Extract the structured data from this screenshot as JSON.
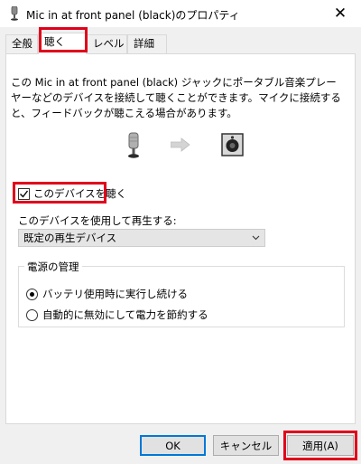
{
  "window": {
    "title": "Mic in at front panel (black)のプロパティ",
    "close_glyph": "✕"
  },
  "tabs": [
    {
      "label": "全般",
      "active": false
    },
    {
      "label": "聴く",
      "active": true
    },
    {
      "label": "レベル",
      "active": false
    },
    {
      "label": "詳細",
      "active": false
    }
  ],
  "listen": {
    "description": "この Mic in at front panel (black) ジャックにポータブル音楽プレーヤーなどのデバイスを接続して聴くことができます。マイクに接続すると、フィードバックが聴こえる場合があります。",
    "checkbox_label": "このデバイスを聴く",
    "checkbox_checked": true,
    "playback_label": "このデバイスを使用して再生する:",
    "playback_selected": "既定の再生デバイス",
    "power_group_title": "電源の管理",
    "radio_continue": "バッテリ使用時に実行し続ける",
    "radio_disable": "自動的に無効にして電力を節約する",
    "radio_selected": "continue"
  },
  "buttons": {
    "ok": "OK",
    "cancel": "キャンセル",
    "apply": "適用(A)"
  },
  "icons": {
    "title": "microphone-icon",
    "mic": "microphone-icon",
    "arrow": "arrow-right-icon",
    "speaker": "speaker-icon"
  },
  "colors": {
    "highlight": "#e0001b",
    "dialog_bg": "#f0f0f0",
    "focus_blue": "#0078d7"
  }
}
